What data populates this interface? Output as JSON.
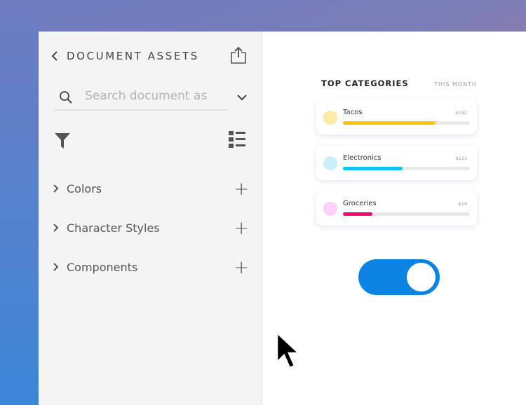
{
  "panel": {
    "title": "DOCUMENT ASSETS",
    "search_placeholder": "Search document assets",
    "sections": [
      {
        "label": "Colors"
      },
      {
        "label": "Character Styles"
      },
      {
        "label": "Components"
      }
    ]
  },
  "preview": {
    "heading": "TOP CATEGORIES",
    "period": "THIS MONTH",
    "categories": [
      {
        "name": "Tacos",
        "amount": "$192",
        "progress": 0.73,
        "color": "#ffc300",
        "dot": "#fde9a6"
      },
      {
        "name": "Electronics",
        "amount": "$121",
        "progress": 0.47,
        "color": "#0ec4f5",
        "dot": "#cdeefd"
      },
      {
        "name": "Groceries",
        "amount": "$19",
        "progress": 0.23,
        "color": "#f5096e",
        "dot": "#fdd0fb"
      }
    ],
    "toggle_on": true
  }
}
